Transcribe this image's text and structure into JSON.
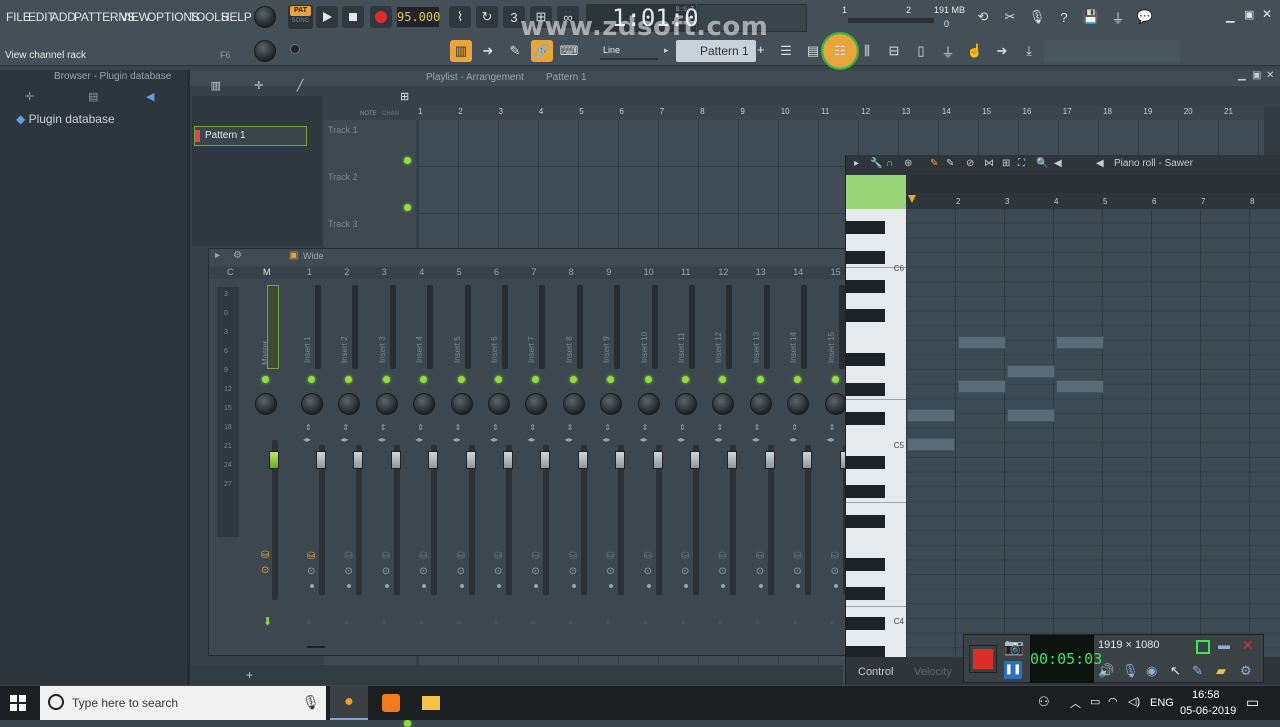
{
  "menu": [
    "FILE",
    "EDIT",
    "ADD",
    "PATTERNS",
    "VIEW",
    "OPTIONS",
    "TOOLS",
    "HELP"
  ],
  "transport": {
    "mode_top": "PAT",
    "mode_bottom": "SONG",
    "tempo": "95.000",
    "time": "1:01:00",
    "time_suffix": "B:S:T",
    "memory": "191 MB",
    "cpu_left": "1",
    "cpu_right": "2",
    "poly": "0"
  },
  "hint": {
    "text": "View channel rack",
    "key": "F6"
  },
  "snap": {
    "label": "Line"
  },
  "pattern_selector": {
    "label": "Pattern 1",
    "plus": "+"
  },
  "watermark": "www.zdsoft.com",
  "browser": {
    "title": "Browser - Plugin database",
    "item": "Plugin database"
  },
  "channel_rack": {
    "pattern": "Pattern 1"
  },
  "playlist": {
    "title": "Playlist - Arrangement",
    "pattern": "Pattern 1",
    "tracks": [
      "Track 1",
      "Track 2",
      "Track 3"
    ],
    "bar_numbers": [
      "1",
      "2",
      "3",
      "4",
      "5",
      "6",
      "7",
      "8",
      "9",
      "10",
      "11",
      "12",
      "13",
      "14",
      "15",
      "16",
      "17",
      "18",
      "19",
      "20",
      "21"
    ],
    "note_tab": "NOTE",
    "chan_tab": "CHAN",
    "pat_tab": "PAT"
  },
  "mixer": {
    "mode": "Wide",
    "c_label": "C",
    "m_label": "M",
    "db_scale": [
      "3",
      "0",
      "3",
      "6",
      "9",
      "12",
      "15",
      "18",
      "21",
      "24",
      "27"
    ],
    "master": "Master",
    "inserts": [
      "Insert 1",
      "Insert 2",
      "Insert 3",
      "Insert 4",
      "Insert 5",
      "Insert 6",
      "Insert 7",
      "Insert 8",
      "Insert 9",
      "Insert 10",
      "Insert 11",
      "Insert 12",
      "Insert 13",
      "Insert 14",
      "Insert 15"
    ],
    "numbers": [
      "1",
      "2",
      "3",
      "4",
      "5",
      "6",
      "7",
      "8",
      "9",
      "10",
      "11",
      "12",
      "13",
      "14",
      "15"
    ]
  },
  "piano_roll": {
    "title": "Piano roll - Sawer",
    "bar_numbers": [
      "2",
      "3",
      "4",
      "5",
      "6",
      "7",
      "8"
    ],
    "octave_labels": [
      "C6",
      "C5",
      "C4"
    ],
    "control_label": "Control",
    "velocity_label": "Velocity"
  },
  "recorder": {
    "timer": "00:05:03",
    "resolution": "1919 × 1080"
  },
  "taskbar": {
    "search_placeholder": "Type here to search",
    "language": "ENG",
    "time": "16:58",
    "date": "05-06-2019"
  },
  "colors": {
    "accent_orange": "#e9a43c",
    "led_green": "#8fdf3c",
    "highlight_circle": "#2fbd3e",
    "record_red": "#e02b2b"
  }
}
